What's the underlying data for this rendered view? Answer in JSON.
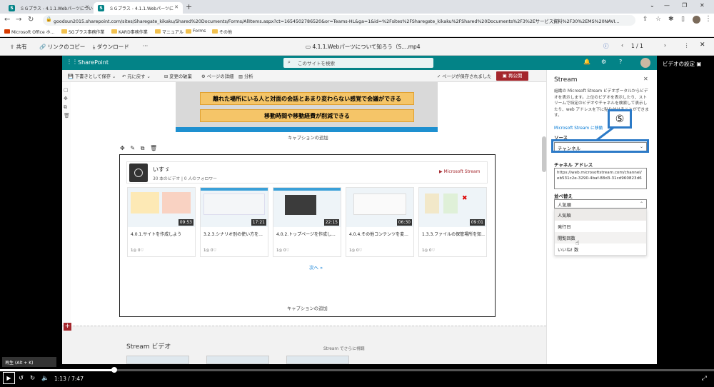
{
  "browser": {
    "tabs": [
      {
        "label": "ＳＧプラス - 4.1.1.Webパーツについ",
        "active": false
      },
      {
        "label": "ＳＧプラス - 4.1.1.Webパーツに",
        "active": true
      }
    ],
    "url": "goodsun2015.sharepoint.com/sites/Sharegate_kikaku/Shared%20Documents/Forms/AllItems.aspx?ct=1654502786520&or=Teams-HL&ga=1&id=%2Fsites%2FSharegate_kikaku%2FShared%20Documents%2F3%2Eサービス資料%2F30%2EMS%20NAVI...",
    "bookmarks": [
      "Microsoft Office ホ...",
      "SGプラス事務作業",
      "KARD事務作業",
      "マニュアル",
      "Forms",
      "その他"
    ]
  },
  "viewer": {
    "share": "共有",
    "copy_link": "リンクのコピー",
    "download": "ダウンロード",
    "more": "···",
    "file_name": "4.1.1.Webパーツについて知ろう（S....mp4",
    "page": "1 / 1",
    "video_settings": "ビデオの設定"
  },
  "sharepoint": {
    "brand": "SharePoint",
    "search_placeholder": "このサイトを検索",
    "cmd": {
      "save_draft": "下書きとして保存",
      "undo": "元に戻す",
      "discard": "変更の破棄",
      "page_details": "ページの詳細",
      "analytics": "分析",
      "saved": "ページが保存されました",
      "republish": "再公開"
    },
    "image_bands": [
      "離れた場所にいる人と対面の会話とあまり変わらない感覚で会議ができる",
      "移動時間や移動経費が削減できる"
    ],
    "caption_add": "キャプションの追加",
    "channel": {
      "name": "いすゞ",
      "meta": "30 本のビデオ | 0 人のフォロワー",
      "brand": "Microsoft Stream"
    },
    "videos": [
      {
        "title": "4.0.1.サイトを作成しよう",
        "duration": "09:53",
        "stats": "1◎ 0♡"
      },
      {
        "title": "3.2.3.シナリオ別の使い方を...",
        "duration": "17:21",
        "stats": "1◎ 0♡"
      },
      {
        "title": "4.0.2.トップページを作成し...",
        "duration": "22:15",
        "stats": "1◎ 0♡"
      },
      {
        "title": "4.0.4.その他コンテンツを変...",
        "duration": "06:30",
        "stats": "1◎ 0♡"
      },
      {
        "title": "1.3.3.ファイルの保管場所を知...",
        "duration": "09:01",
        "stats": "1◎ 0♡"
      }
    ],
    "next": "次へ »",
    "lower_title": "Stream ビデオ",
    "lower_more": "Stream でさらに視聴"
  },
  "pane": {
    "title": "Stream",
    "desc": "組織の Microsoft Stream ビデオポータルからビデオを表示します。上位のビデオを表示したり、ストリームで特定のビデオやチャネルを検索して表示したり、web アドレスを下に貼り付けることができます。",
    "link": "Microsoft Stream に移動",
    "source_label": "ソース",
    "source_value": "チャンネル",
    "callout": "⑤",
    "addr_label": "チャネル アドレス",
    "addr_value": "https://web.microsoftstream.com/channel/eb531c2e-3290-4baf-88d3-31cd960823d6",
    "sort_label": "並べ替え",
    "sort_value": "人気順",
    "sort_options": [
      "人気順",
      "発行日",
      "閲覧回数",
      "いいね! 数"
    ]
  },
  "player": {
    "tooltip": "再生 (Alt + K)",
    "time": "1:13  /  7:47",
    "progress": 0.16
  }
}
